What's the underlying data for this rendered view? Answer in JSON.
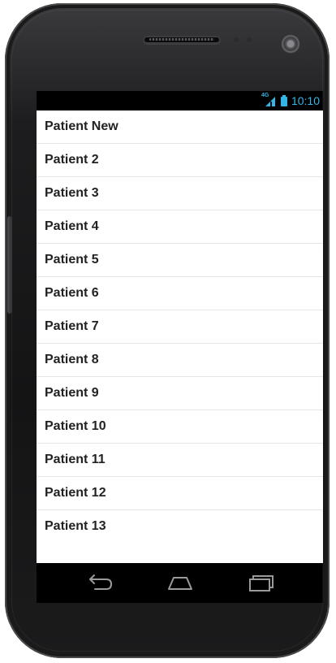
{
  "status_bar": {
    "network_type": "4G",
    "time": "10:10",
    "accent_color": "#33b5e5"
  },
  "patients": {
    "items": [
      {
        "label": "Patient New"
      },
      {
        "label": "Patient 2"
      },
      {
        "label": "Patient 3"
      },
      {
        "label": "Patient 4"
      },
      {
        "label": "Patient 5"
      },
      {
        "label": "Patient 6"
      },
      {
        "label": "Patient 7"
      },
      {
        "label": "Patient 8"
      },
      {
        "label": "Patient 9"
      },
      {
        "label": "Patient 10"
      },
      {
        "label": "Patient 11"
      },
      {
        "label": "Patient 12"
      },
      {
        "label": "Patient 13"
      }
    ]
  },
  "navigation": {
    "buttons": [
      {
        "icon": "back-icon"
      },
      {
        "icon": "home-icon"
      },
      {
        "icon": "recent-apps-icon"
      }
    ]
  },
  "colors": {
    "list_background": "#ffffff",
    "divider": "#e6e6e6",
    "item_text": "#222222",
    "bar_background": "#000000"
  }
}
